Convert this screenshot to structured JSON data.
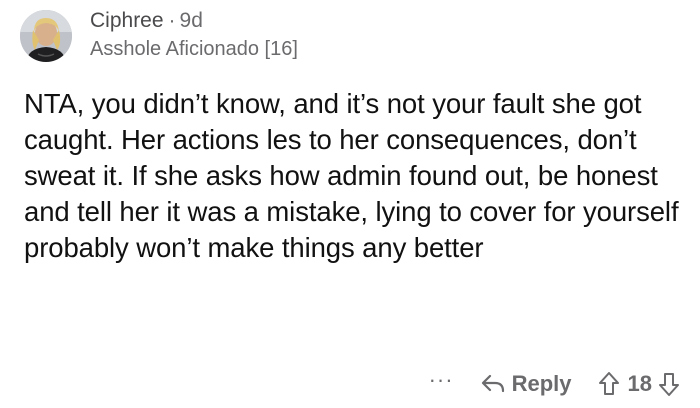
{
  "comment": {
    "author": "Ciphree",
    "separator": "·",
    "age": "9d",
    "flair": "Asshole Aficionado [16]",
    "body": "NTA, you didn’t know, and it’s not your fault she got caught. Her actions les to her consequences, don’t sweat it. If she asks how admin found out, be honest and tell her it was a mistake, lying to cover for yourself probably won’t make things any better",
    "actions": {
      "more_label": "···",
      "reply_label": "Reply",
      "score": "18"
    }
  },
  "icons": {
    "avatar": "user-avatar",
    "reply": "reply-arrow-icon",
    "upvote": "upvote-arrow-icon",
    "downvote": "downvote-arrow-icon"
  },
  "colors": {
    "text": "#111111",
    "meta": "#6b6b6e",
    "background": "#ffffff"
  }
}
